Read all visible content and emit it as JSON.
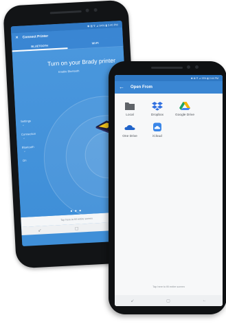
{
  "back_phone": {
    "status_bar": "✱ ⊠ ⊽ ⊿ 94% ▮ 2:40 PM",
    "appbar": {
      "close_glyph": "✕",
      "title": "Connect Printer"
    },
    "tabs": [
      {
        "label": "BLUETOOTH",
        "active": true
      },
      {
        "label": "WI-FI",
        "active": false
      }
    ],
    "heading": "Turn on your Brady printer",
    "subheading": "Enable Bluetooth",
    "steps": [
      "Settings",
      "Connection",
      "Bluetooth",
      "On"
    ],
    "carousel_dots": "● ● ●",
    "bottom_hint": "Tap here to fill entire screen",
    "nav": {
      "recents": "↙",
      "home": "▢",
      "back": "←"
    }
  },
  "front_phone": {
    "status_bar": "✱ ⊠ ⊽ ⊿ 93% ▮ 2:44 PM",
    "appbar": {
      "back_glyph": "←",
      "title": "Open From"
    },
    "sources": [
      {
        "label": "Local",
        "icon": "folder-icon",
        "color": "#5f6368"
      },
      {
        "label": "Dropbox",
        "icon": "dropbox-icon",
        "color": "#2f6fe0"
      },
      {
        "label": "Google Drive",
        "icon": "google-drive-icon",
        "color": "#f5b400"
      },
      {
        "label": "One Drive",
        "icon": "onedrive-icon",
        "color": "#1f63c9"
      },
      {
        "label": "iCloud",
        "icon": "icloud-icon",
        "color": "#3a86e8"
      }
    ],
    "bottom_hint": "Tap here to fill entire screen",
    "nav": {
      "recents": "↙",
      "home": "▢",
      "back": "←"
    }
  },
  "colors": {
    "primary": "#3a86d3",
    "primary_dark": "#2f78c4"
  }
}
